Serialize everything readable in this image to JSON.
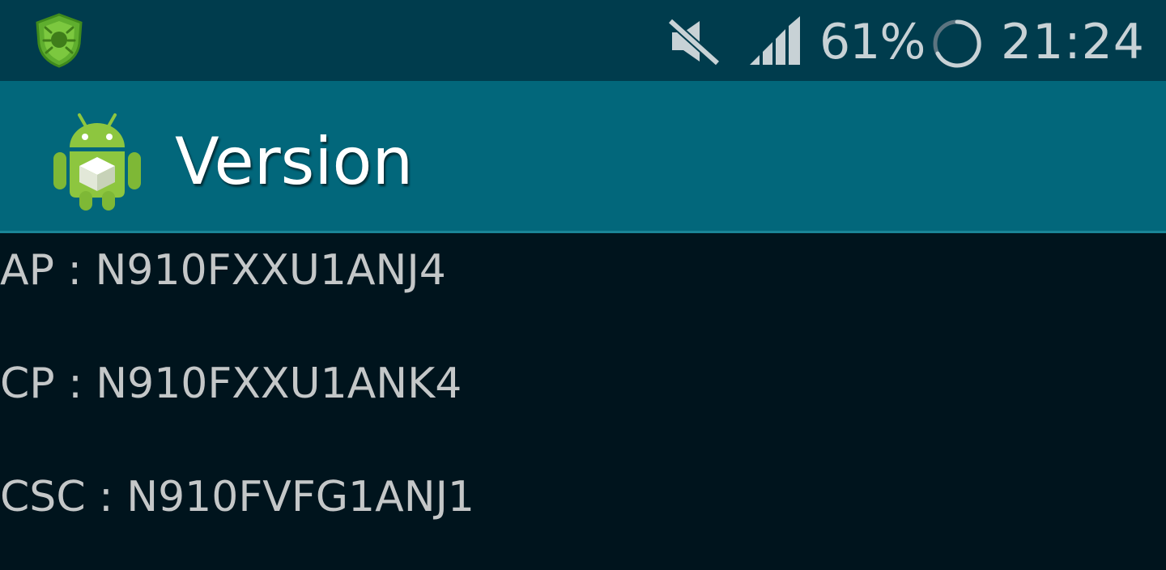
{
  "status_bar": {
    "notification_icon": "shield-app-icon",
    "mute_icon": "mute-icon",
    "signal_icon": "signal-strength-icon",
    "battery_percent": "61%",
    "loading_icon": "loading-spinner-icon",
    "time": "21:24"
  },
  "action_bar": {
    "app_icon": "android-robot-icon",
    "title": "Version"
  },
  "versions": {
    "ap": "AP : N910FXXU1ANJ4",
    "cp": "CP : N910FXXU1ANK4",
    "csc": "CSC : N910FVFG1ANJ1"
  },
  "colors": {
    "status_bar_bg": "#003c4d",
    "action_bar_bg": "#02677b",
    "content_bg": "#00141d",
    "text": "#c4c7c8"
  }
}
